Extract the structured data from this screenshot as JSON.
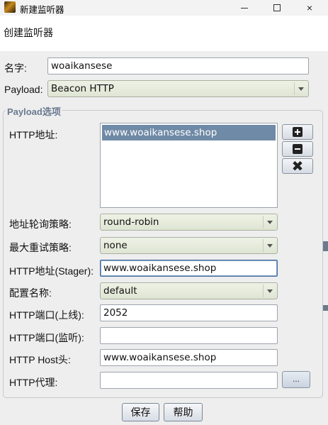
{
  "window": {
    "title": "新建监听器",
    "app_icon": "cobalt-strike-icon",
    "controls": {
      "minimize": "minimize-icon",
      "maximize": "maximize-icon",
      "close": "×"
    }
  },
  "header": {
    "text": "创建监听器"
  },
  "form": {
    "name_label": "名字:",
    "name_value": "woaikansese",
    "payload_label": "Payload:",
    "payload_value": "Beacon HTTP"
  },
  "payload_options": {
    "group_title": "Payload选项",
    "http_hosts_label": "HTTP地址:",
    "http_hosts": [
      "www.woaikansese.shop"
    ],
    "add_button_icon": "plus-icon",
    "remove_button_icon": "minus-icon",
    "clear_button": "✖",
    "rotation_label": "地址轮询策略:",
    "rotation_value": "round-robin",
    "retry_label": "最大重试策略:",
    "retry_value": "none",
    "stager_label": "HTTP地址(Stager):",
    "stager_value": "www.woaikansese.shop",
    "profile_label": "配置名称:",
    "profile_value": "default",
    "port_c2_label": "HTTP端口(上线):",
    "port_c2_value": "2052",
    "port_bind_label": "HTTP端口(监听):",
    "port_bind_value": "",
    "host_header_label": "HTTP Host头:",
    "host_header_value": "www.woaikansese.shop",
    "proxy_label": "HTTP代理:",
    "proxy_value": "",
    "proxy_button": "..."
  },
  "actions": {
    "save": "保存",
    "help": "帮助"
  },
  "colors": {
    "selection": "#6f8aa6",
    "group_title": "#6a7a90",
    "combo_bg": "#dfe5d3"
  }
}
